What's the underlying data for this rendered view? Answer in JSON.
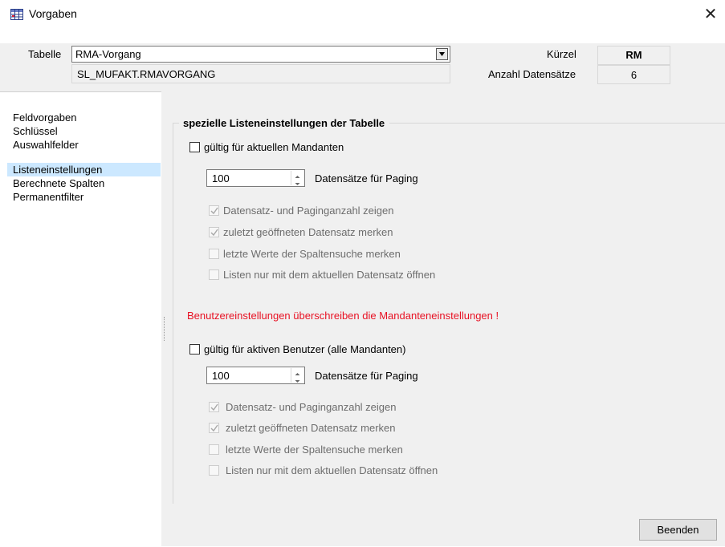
{
  "window": {
    "title": "Vorgaben",
    "close_glyph": "✕"
  },
  "header": {
    "table_label": "Tabelle",
    "table_value": "RMA-Vorgang",
    "table_db_name": "SL_MUFAKT.RMAVORGANG",
    "kuerzel_label": "Kürzel",
    "kuerzel_value": "RM",
    "count_label": "Anzahl Datensätze",
    "count_value": "6"
  },
  "sidebar": {
    "items": [
      {
        "label": "Feldvorgaben"
      },
      {
        "label": "Schlüssel"
      },
      {
        "label": "Auswahlfelder"
      },
      {
        "label": "Listeneinstellungen",
        "selected": true
      },
      {
        "label": "Berechnete Spalten"
      },
      {
        "label": "Permanentfilter"
      }
    ]
  },
  "main": {
    "group_title": "spezielle Listeneinstellungen der Tabelle",
    "mandant": {
      "enable_label": "gültig für aktuellen Mandanten",
      "enable_checked": false,
      "paging_value": "100",
      "paging_label": "Datensätze für Paging",
      "options": [
        {
          "label": "Datensatz- und Paginganzahl zeigen",
          "checked": true
        },
        {
          "label": "zuletzt geöffneten Datensatz merken",
          "checked": true
        },
        {
          "label": "letzte Werte der Spaltensuche merken",
          "checked": false
        },
        {
          "label": "Listen nur mit dem aktuellen Datensatz öffnen",
          "checked": false
        }
      ]
    },
    "warning": "Benutzereinstellungen überschreiben die Mandanteneinstellungen !",
    "benutzer": {
      "enable_label": "gültig für aktiven Benutzer (alle Mandanten)",
      "enable_checked": false,
      "paging_value": "100",
      "paging_label": "Datensätze für Paging",
      "options": [
        {
          "label": "Datensatz- und Paginganzahl zeigen",
          "checked": true
        },
        {
          "label": "zuletzt geöffneten Datensatz merken",
          "checked": true
        },
        {
          "label": "letzte Werte der Spaltensuche merken",
          "checked": false
        },
        {
          "label": "Listen nur mit dem aktuellen Datensatz öffnen",
          "checked": false
        }
      ]
    }
  },
  "footer": {
    "close_button_label": "Beenden"
  },
  "colors": {
    "selection": "#cce8ff",
    "warning": "#e81123",
    "panel": "#f0f0f0"
  }
}
